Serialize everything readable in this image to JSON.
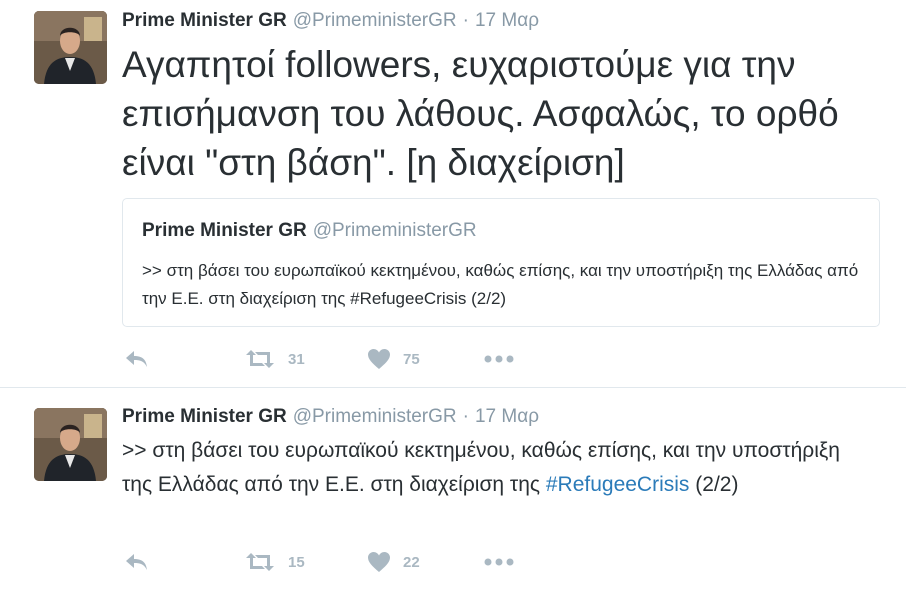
{
  "tweets": [
    {
      "author_name": "Prime Minister GR",
      "handle": "@PrimeministerGR",
      "separator": "·",
      "date": "17 Μαρ",
      "text": "Αγαπητοί followers, ευχαριστούμε για την επισήμανση του λάθους. Ασφαλώς, το ορθό είναι \"στη βάση\". [η διαχείριση]",
      "quoted": {
        "author_name": "Prime Minister GR",
        "handle": "@PrimeministerGR",
        "text": ">> στη βάσει του ευρωπαϊκού κεκτημένου, καθώς επίσης, και την υποστήριξη της Ελλάδας από την Ε.Ε. στη διαχείριση της #RefugeeCrisis (2/2)"
      },
      "retweets": "31",
      "likes": "75"
    },
    {
      "author_name": "Prime Minister GR",
      "handle": "@PrimeministerGR",
      "separator": "·",
      "date": "17 Μαρ",
      "text_before": ">> στη βάσει του ευρωπαϊκού κεκτημένου, καθώς επίσης, και την υποστήριξη της Ελλάδας από την Ε.Ε. στη διαχείριση της ",
      "hashtag": "#RefugeeCrisis",
      "text_after": " (2/2)",
      "retweets": "15",
      "likes": "22"
    }
  ],
  "icons": {
    "reply": "reply-icon",
    "retweet": "retweet-icon",
    "like": "heart-icon",
    "more": "more-icon",
    "action_color": "#aab8c2"
  },
  "colors": {
    "text": "#292f33",
    "muted": "#8899a6",
    "hashtag": "#2b7bb9",
    "border": "#e1e8ed"
  }
}
